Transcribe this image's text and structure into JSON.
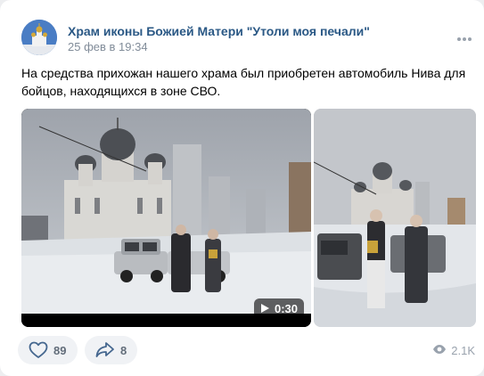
{
  "post": {
    "author": "Храм иконы Божией Матери \"Утоли моя печали\"",
    "timestamp": "25 фев в 19:34",
    "text": "На средства прихожан нашего храма был приобретен автомобиль Нива для бойцов, находящихся в зоне СВО."
  },
  "media": {
    "video": {
      "duration": "0:30"
    }
  },
  "actions": {
    "likes": "89",
    "shares": "8",
    "views": "2.1K"
  },
  "icons": {
    "more": "more-horizontal-icon",
    "play": "play-icon",
    "like": "heart-icon",
    "share": "share-arrow-icon",
    "views": "eye-icon"
  },
  "colors": {
    "author": "#2a5885",
    "secondary_text": "#818c99",
    "action_background": "#f0f2f5",
    "action_icon": "#45678f"
  }
}
